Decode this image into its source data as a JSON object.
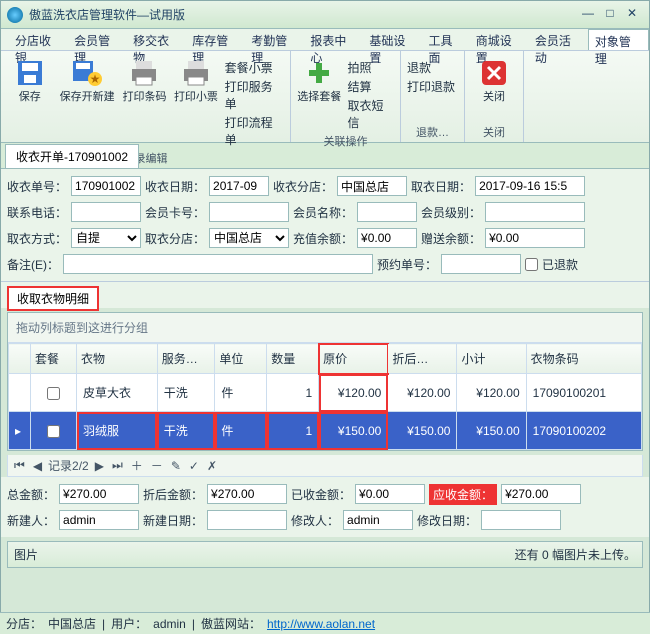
{
  "window": {
    "title": "傲蓝洗衣店管理软件—试用版"
  },
  "menu": {
    "items": [
      "分店收银",
      "会员管理",
      "移交衣物",
      "库存管理",
      "考勤管理",
      "报表中心",
      "基础设置",
      "工具面",
      "商城设置",
      "会员活动",
      "对象管理"
    ],
    "active": 10
  },
  "ribbon": {
    "g1": {
      "label": "记录编辑",
      "save": "保存",
      "saveNew": "保存开新建",
      "barcode": "打印条码",
      "ticket": "打印小票",
      "lines": [
        "套餐小票",
        "打印服务单",
        "打印流程单"
      ]
    },
    "g2": {
      "label": "关联操作",
      "select": "选择套餐",
      "lines": [
        "拍照",
        "结算",
        "取衣短信"
      ]
    },
    "g3": {
      "label": "退款…",
      "lines": [
        "退款",
        "打印退款"
      ]
    },
    "g4": {
      "label": "关闭",
      "close": "关闭"
    }
  },
  "docTab": "收衣开单-170901002",
  "form": {
    "orderNo_l": "收衣单号：",
    "orderNo": "170901002",
    "orderDate_l": "收衣日期：",
    "orderDate": "2017-09",
    "branch_l": "收衣分店：",
    "branch": "中国总店",
    "pickDate_l": "取衣日期：",
    "pickDate": "2017-09-16 15:5",
    "phone_l": "联系电话：",
    "phone": "",
    "cardNo_l": "会员卡号：",
    "cardNo": "",
    "memberName_l": "会员名称：",
    "memberName": "",
    "memberLvl_l": "会员级别：",
    "memberLvl": "",
    "pickWay_l": "取衣方式：",
    "pickWay": "自提",
    "pickBranch_l": "取衣分店：",
    "pickBranch": "中国总店",
    "balance_l": "充值余额：",
    "balance": "¥0.00",
    "gift_l": "赠送余额：",
    "gift": "¥0.00",
    "remark_l": "备注(E)：",
    "remark": "",
    "reserve_l": "预约单号：",
    "reserve": "",
    "refunded_l": "已退款"
  },
  "subtab": "收取衣物明细",
  "grid": {
    "groupHint": "拖动列标题到这进行分组",
    "cols": [
      "套餐",
      "衣物",
      "服务…",
      "单位",
      "数量",
      "原价",
      "折后…",
      "小计",
      "衣物条码"
    ],
    "rows": [
      {
        "pkg": false,
        "cloth": "皮草大衣",
        "svc": "干洗",
        "unit": "件",
        "qty": "1",
        "price": "¥120.00",
        "disc": "¥120.00",
        "sub": "¥120.00",
        "code": "1709010020​1"
      },
      {
        "pkg": false,
        "cloth": "羽绒服",
        "svc": "干洗",
        "unit": "件",
        "qty": "1",
        "price": "¥150.00",
        "disc": "¥150.00",
        "sub": "¥150.00",
        "code": "17090100202"
      }
    ]
  },
  "pager": {
    "text": "记录2/2"
  },
  "totals": {
    "total_l": "总金额：",
    "total": "¥270.00",
    "discTotal_l": "折后金额：",
    "discTotal": "¥270.00",
    "paid_l": "已收金额：",
    "paid": "¥0.00",
    "due_l": "应收金额：",
    "due": "¥270.00",
    "creator_l": "新建人：",
    "creator": "admin",
    "createDate_l": "新建日期：",
    "createDate": "",
    "modifier_l": "修改人：",
    "modifier": "admin",
    "modifyDate_l": "修改日期：",
    "modifyDate": ""
  },
  "picbar": {
    "label": "图片",
    "hint": "还有 0 幅图片未上传。"
  },
  "status": {
    "branch_l": "分店：",
    "branch": "中国总店",
    "user_l": "用户：",
    "user": "admin",
    "site_l": "傲蓝网站：",
    "site": "http://www.aolan.net"
  }
}
